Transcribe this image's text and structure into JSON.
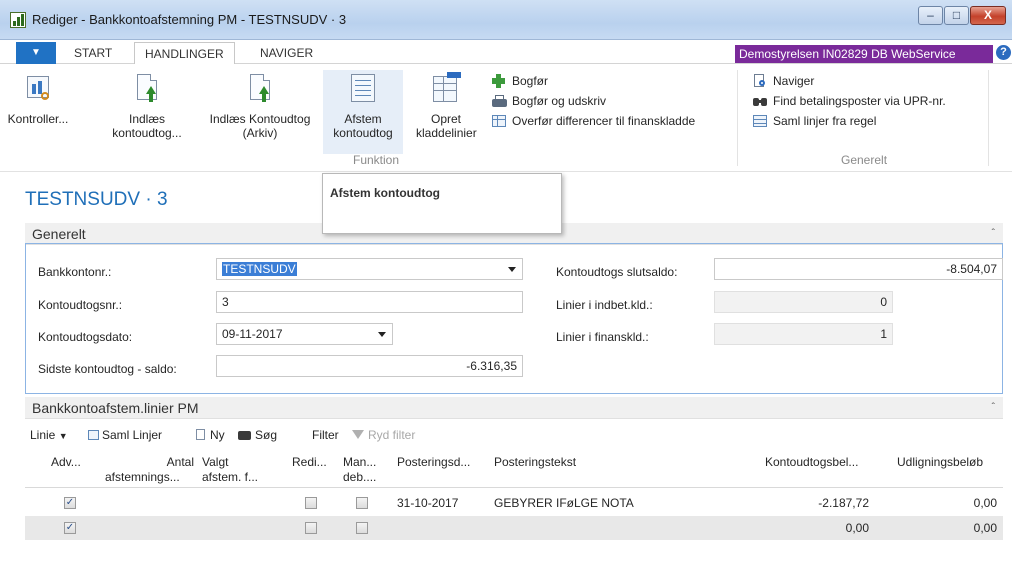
{
  "window": {
    "title": "Rediger - Bankkontoafstemning PM - TESTNSUDV · 3",
    "minimize": "–",
    "maximize": "□",
    "close": "X"
  },
  "ribbon_tabs": {
    "menu_glyph": "▼",
    "tabs": [
      "START",
      "HANDLINGER",
      "NAVIGER"
    ],
    "active": "HANDLINGER",
    "company": "Demostyrelsen IN02829 DB WebService",
    "help": "?"
  },
  "ribbon": {
    "funktion": {
      "buttons": [
        "Kontroller...",
        "Indlæs kontoudtog...",
        "Indlæs Kontoudtog (Arkiv)",
        "Afstem kontoudtog",
        "Opret kladdelinier"
      ],
      "small": [
        "Bogfør",
        "Bogfør og udskriv",
        "Overfør differencer til finanskladde"
      ],
      "group_label": "Funktion"
    },
    "generelt": {
      "small": [
        "Naviger",
        "Find betalingsposter via UPR-nr.",
        "Saml linjer fra regel"
      ],
      "group_label": "Generelt"
    }
  },
  "tooltip": {
    "title": "Afstem kontoudtog"
  },
  "page": {
    "title": "TESTNSUDV · 3"
  },
  "general": {
    "header": "Generelt",
    "bank_account_label": "Bankkontonr.:",
    "bank_account_value": "TESTNSUDV",
    "statement_no_label": "Kontoudtogsnr.:",
    "statement_no_value": "3",
    "statement_date_label": "Kontoudtogsdato:",
    "statement_date_value": "09-11-2017",
    "last_balance_label": "Sidste kontoudtog - saldo:",
    "last_balance_value": "-6.316,35",
    "ending_balance_label": "Kontoudtogs slutsaldo:",
    "ending_balance_value": "-8.504,07",
    "lines_payment_label": "Linier i indbet.kld.:",
    "lines_payment_value": "0",
    "lines_gl_label": "Linier i finanskld.:",
    "lines_gl_value": "1"
  },
  "lines": {
    "header": "Bankkontoafstem.linier PM",
    "toolbar": {
      "linie": "Linie",
      "saml": "Saml Linjer",
      "ny": "Ny",
      "sog": "Søg",
      "filter": "Filter",
      "ryd": "Ryd filter"
    },
    "columns": {
      "adv": "Adv...",
      "antal_1": "Antal",
      "antal_2": "afstemnings...",
      "valgt_1": "Valgt",
      "valgt_2": "afstem. f...",
      "redi": "Redi...",
      "man_1": "Man...",
      "man_2": "deb....",
      "posteringsdato": "Posteringsd...",
      "posteringstekst": "Posteringstekst",
      "kontoudtogsbelob": "Kontoudtogsbel...",
      "udligningsbelob": "Udligningsbeløb"
    },
    "rows": [
      {
        "adv": true,
        "redi": false,
        "man": false,
        "date": "31-10-2017",
        "text": "GEBYRER IFøLGE NOTA",
        "statement_amount": "-2.187,72",
        "applied_amount": "0,00"
      },
      {
        "adv": true,
        "redi": false,
        "man": false,
        "date": "",
        "text": "",
        "statement_amount": "0,00",
        "applied_amount": "0,00"
      }
    ]
  }
}
